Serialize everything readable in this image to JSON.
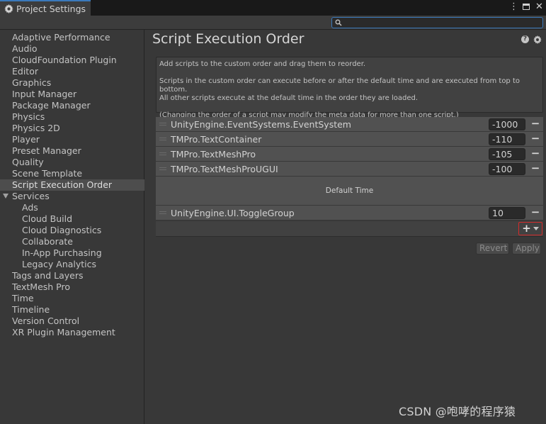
{
  "window": {
    "tab_title": "Project Settings",
    "tab_icon": "gear-icon",
    "controls": [
      "more-vertical-icon",
      "maximize-icon",
      "close-icon"
    ]
  },
  "search": {
    "value": "",
    "placeholder": ""
  },
  "sidebar": {
    "items": [
      {
        "label": "Adaptive Performance"
      },
      {
        "label": "Audio"
      },
      {
        "label": "CloudFoundation Plugin"
      },
      {
        "label": "Editor"
      },
      {
        "label": "Graphics"
      },
      {
        "label": "Input Manager"
      },
      {
        "label": "Package Manager"
      },
      {
        "label": "Physics"
      },
      {
        "label": "Physics 2D"
      },
      {
        "label": "Player"
      },
      {
        "label": "Preset Manager"
      },
      {
        "label": "Quality"
      },
      {
        "label": "Scene Template"
      },
      {
        "label": "Script Execution Order",
        "selected": true
      },
      {
        "label": "Services",
        "expanded": true
      },
      {
        "label": "Ads",
        "child": true
      },
      {
        "label": "Cloud Build",
        "child": true
      },
      {
        "label": "Cloud Diagnostics",
        "child": true
      },
      {
        "label": "Collaborate",
        "child": true
      },
      {
        "label": "In-App Purchasing",
        "child": true
      },
      {
        "label": "Legacy Analytics",
        "child": true
      },
      {
        "label": "Tags and Layers"
      },
      {
        "label": "TextMesh Pro"
      },
      {
        "label": "Time"
      },
      {
        "label": "Timeline"
      },
      {
        "label": "Version Control"
      },
      {
        "label": "XR Plugin Management"
      }
    ]
  },
  "main": {
    "title": "Script Execution Order",
    "info": {
      "line1": "Add scripts to the custom order and drag them to reorder.",
      "line2": "Scripts in the custom order can execute before or after the default time and are executed from top to bottom.",
      "line3": "All other scripts execute at the default time in the order they are loaded.",
      "line4": "(Changing the order of a script may modify the meta data for more than one script.)"
    },
    "scripts_before": [
      {
        "name": "UnityEngine.EventSystems.EventSystem",
        "order": "-1000"
      },
      {
        "name": "TMPro.TextContainer",
        "order": "-110"
      },
      {
        "name": "TMPro.TextMeshPro",
        "order": "-105"
      },
      {
        "name": "TMPro.TextMeshProUGUI",
        "order": "-100"
      }
    ],
    "default_time_label": "Default Time",
    "scripts_after": [
      {
        "name": "UnityEngine.UI.ToggleGroup",
        "order": "10"
      }
    ],
    "remove_label": "−",
    "add_label": "+",
    "revert_label": "Revert",
    "apply_label": "Apply"
  },
  "watermark": "CSDN @咆哮的程序猿",
  "colors": {
    "accent": "#3a79bb",
    "highlight_border": "#d42a2a",
    "selected_bg": "#4d4d4d"
  }
}
